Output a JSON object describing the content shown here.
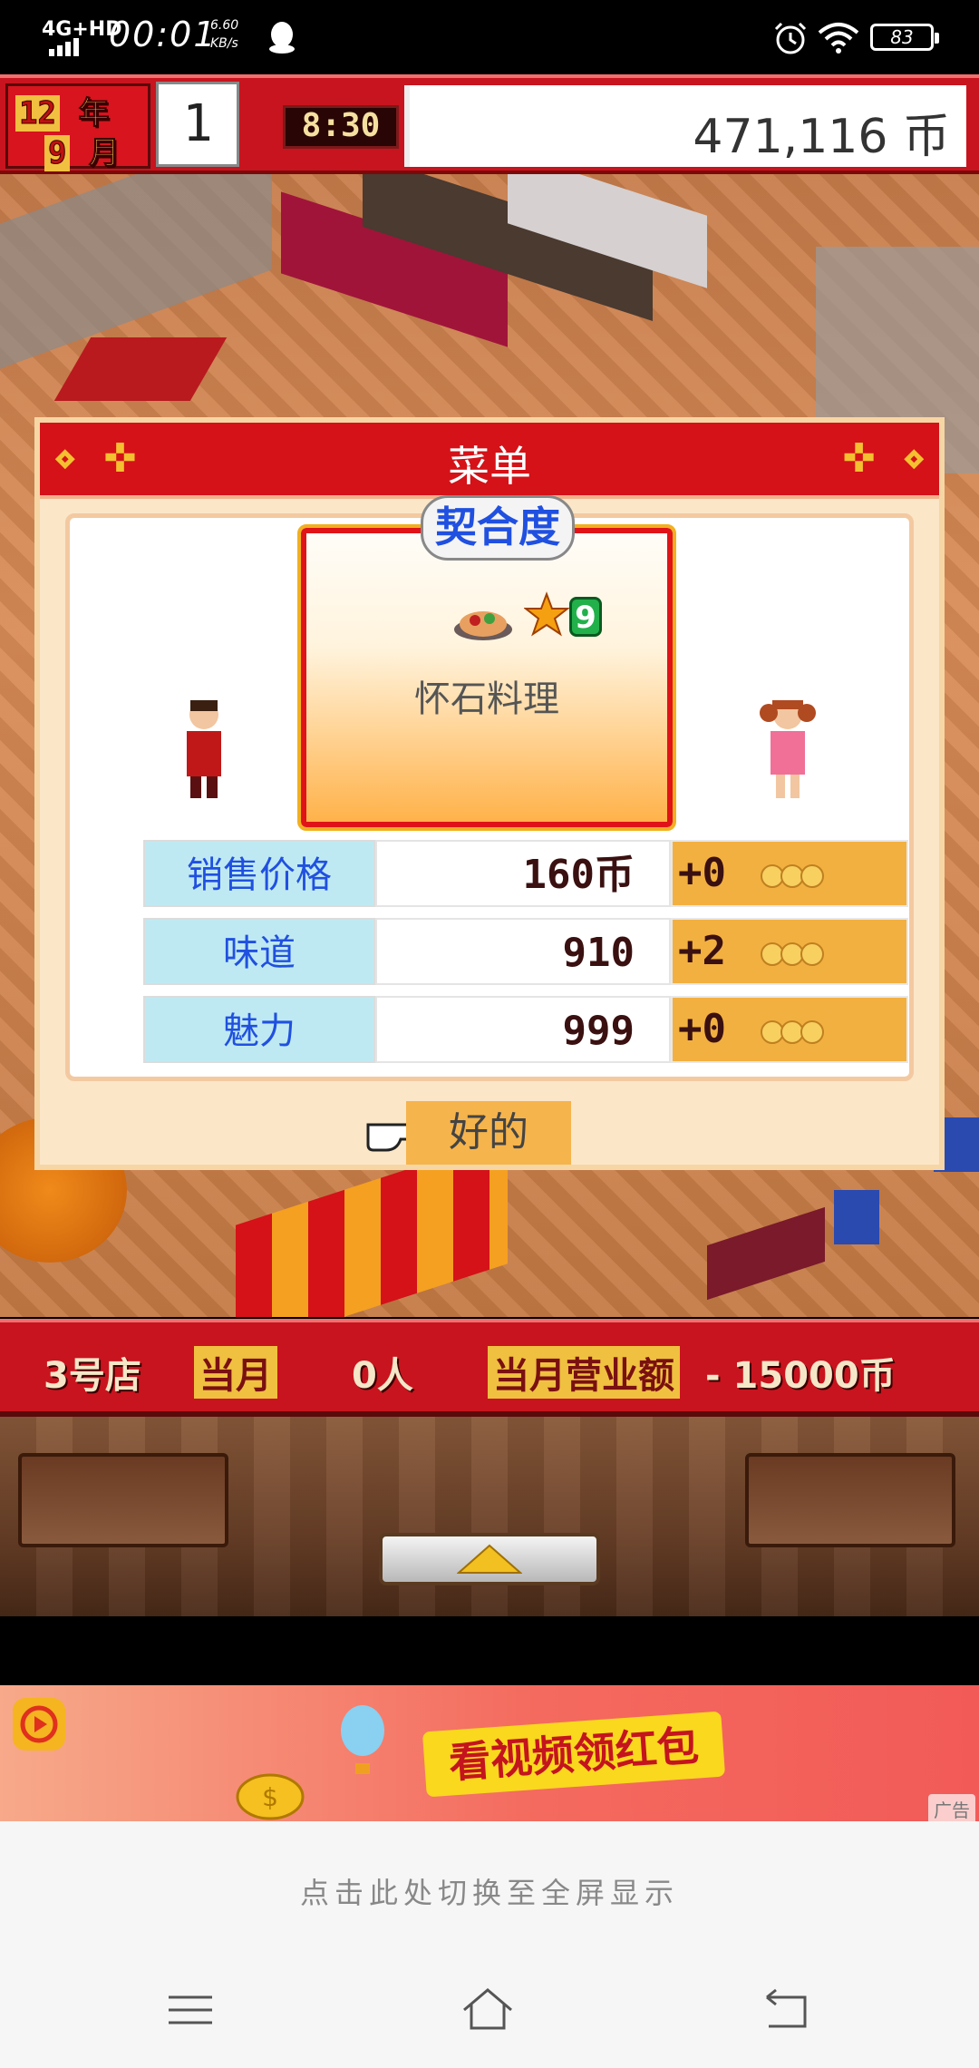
{
  "status_bar": {
    "network": "4G+HD",
    "time": "00:01",
    "speed_value": "6.60",
    "speed_unit": "KB/s",
    "battery": "83",
    "icons": [
      "signal-icon",
      "qq-icon",
      "alarm-icon",
      "wifi-icon",
      "battery-icon"
    ]
  },
  "game_header": {
    "year_num": "12",
    "year_unit": "年",
    "month_num": "9",
    "month_unit": "月",
    "day": "1",
    "clock": "8:30",
    "money": "471,116 币"
  },
  "menu_dialog": {
    "title": "菜单",
    "badge": "契合度",
    "dish_name": "怀石料理",
    "star_count": "9",
    "stats": [
      {
        "label": "销售价格",
        "value": "160币",
        "delta": "+0"
      },
      {
        "label": "味道",
        "value": "910",
        "delta": "+2"
      },
      {
        "label": "魅力",
        "value": "999",
        "delta": "+0"
      }
    ],
    "confirm_label": "好的"
  },
  "info_bar": {
    "store": "3号店",
    "month_label": "当月",
    "visitors": "0人",
    "revenue_label": "当月营业额",
    "revenue": "- 15000币"
  },
  "ad": {
    "text": "看视频领红包",
    "tag": "广告"
  },
  "fullscreen_prompt": "点击此处切换至全屏显示",
  "colors": {
    "header_red": "#c8141e",
    "dialog_bg": "#fbe6c8",
    "label_blue_bg": "#bfe9f2",
    "delta_orange": "#f2b040",
    "ad_yellow": "#f9d81e"
  }
}
